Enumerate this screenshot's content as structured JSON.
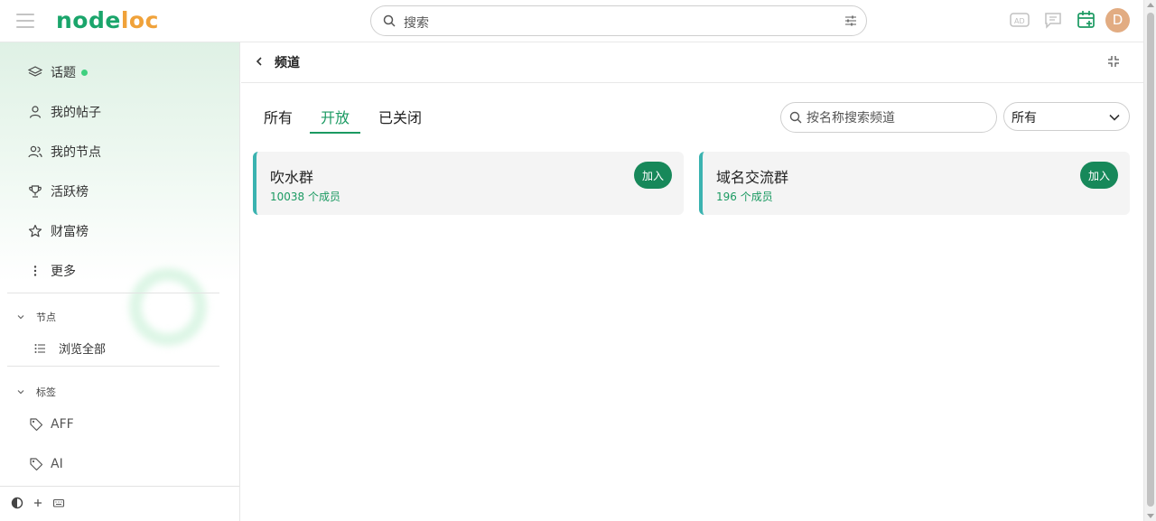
{
  "header": {
    "logo_part1": "node",
    "logo_part2": "loc",
    "search_placeholder": "搜索",
    "avatar_letter": "D"
  },
  "sidebar": {
    "items": [
      {
        "label": "话题",
        "icon": "layers-icon",
        "has_dot": true
      },
      {
        "label": "我的帖子",
        "icon": "user-icon"
      },
      {
        "label": "我的节点",
        "icon": "users-icon"
      },
      {
        "label": "活跃榜",
        "icon": "trophy-icon"
      },
      {
        "label": "财富榜",
        "icon": "star-icon"
      },
      {
        "label": "更多",
        "icon": "more-vertical-icon"
      }
    ],
    "nodes_section": {
      "title": "节点",
      "items": [
        {
          "label": "浏览全部",
          "icon": "list-icon"
        }
      ]
    },
    "tags_section": {
      "title": "标签",
      "items": [
        {
          "label": "AFF",
          "icon": "tag-icon"
        },
        {
          "label": "AI",
          "icon": "tag-icon"
        }
      ]
    }
  },
  "main": {
    "title": "频道",
    "tabs": [
      {
        "label": "所有",
        "active": false
      },
      {
        "label": "开放",
        "active": true
      },
      {
        "label": "已关闭",
        "active": false
      }
    ],
    "channel_search_placeholder": "按名称搜索频道",
    "filter_value": "所有",
    "channels": [
      {
        "name": "吹水群",
        "members": "10038 个成员",
        "join_label": "加入"
      },
      {
        "name": "域名交流群",
        "members": "196 个成员",
        "join_label": "加入"
      }
    ]
  },
  "colors": {
    "accent": "#1b9a62",
    "logo_green": "#1aa56b",
    "logo_orange": "#f0a23a",
    "card_border": "#3bb3b0"
  }
}
